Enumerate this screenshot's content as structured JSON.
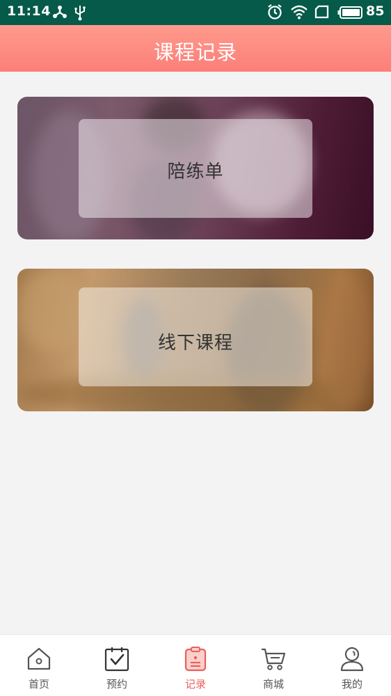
{
  "status_bar": {
    "time": "11:14",
    "battery_percent": "85",
    "icons": [
      "network-share-icon",
      "usb-icon",
      "alarm-icon",
      "wifi-icon",
      "sim-icon",
      "battery-icon"
    ],
    "background_color": "#055a49"
  },
  "header": {
    "title": "课程记录",
    "background_color": "#fb8a82"
  },
  "cards": [
    {
      "label": "陪练单"
    },
    {
      "label": "线下课程"
    }
  ],
  "bottom_nav": {
    "active_index": 2,
    "active_color": "#e8605c",
    "items": [
      {
        "label": "首页",
        "icon": "home-icon"
      },
      {
        "label": "预约",
        "icon": "calendar-check-icon"
      },
      {
        "label": "记录",
        "icon": "clipboard-icon"
      },
      {
        "label": "商城",
        "icon": "cart-icon"
      },
      {
        "label": "我的",
        "icon": "user-icon"
      }
    ]
  }
}
